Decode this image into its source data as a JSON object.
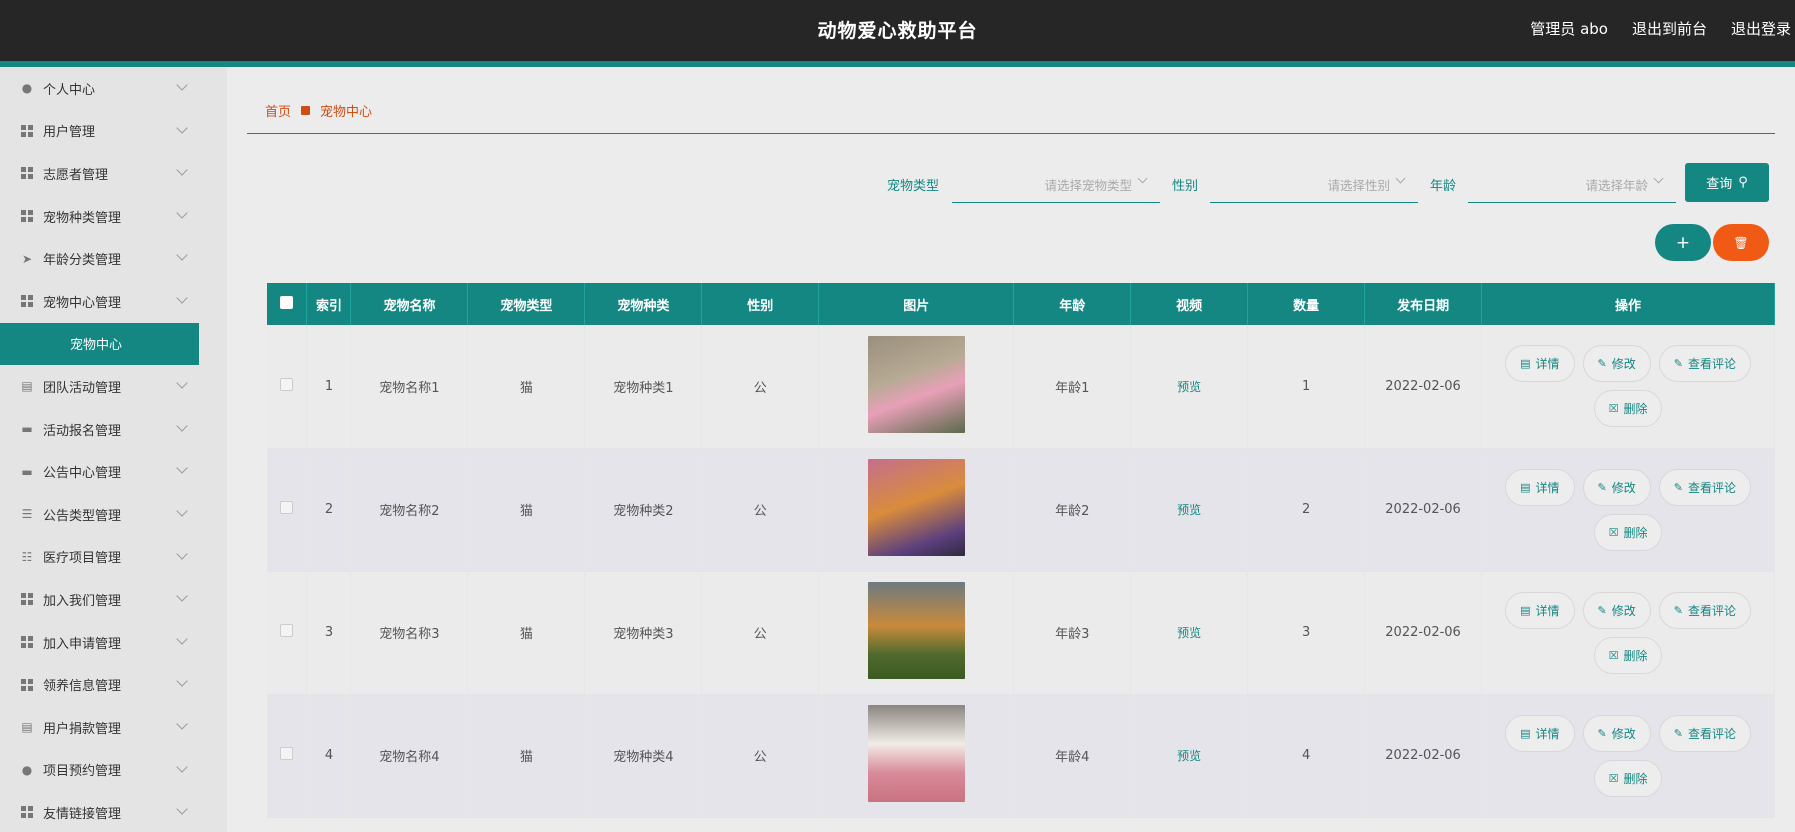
{
  "header": {
    "title": "动物爱心救助平台",
    "admin": "管理员 abo",
    "to_front": "退出到前台",
    "logout": "退出登录"
  },
  "sidebar": {
    "items": [
      {
        "label": "个人中心",
        "icon": "user-icon"
      },
      {
        "label": "用户管理",
        "icon": "grid-icon"
      },
      {
        "label": "志愿者管理",
        "icon": "grid-icon"
      },
      {
        "label": "宠物种类管理",
        "icon": "grid-icon"
      },
      {
        "label": "年龄分类管理",
        "icon": "send-icon"
      },
      {
        "label": "宠物中心管理",
        "icon": "grid-icon"
      },
      {
        "label": "宠物中心",
        "icon": "",
        "active": true
      },
      {
        "label": "团队活动管理",
        "icon": "clipboard-icon"
      },
      {
        "label": "活动报名管理",
        "icon": "monitor-icon"
      },
      {
        "label": "公告中心管理",
        "icon": "monitor-icon"
      },
      {
        "label": "公告类型管理",
        "icon": "list-icon"
      },
      {
        "label": "医疗项目管理",
        "icon": "sliders-icon"
      },
      {
        "label": "加入我们管理",
        "icon": "grid-icon"
      },
      {
        "label": "加入申请管理",
        "icon": "grid-icon"
      },
      {
        "label": "领养信息管理",
        "icon": "grid-icon"
      },
      {
        "label": "用户捐款管理",
        "icon": "clipboard-icon"
      },
      {
        "label": "项目预约管理",
        "icon": "user-icon"
      },
      {
        "label": "友情链接管理",
        "icon": "grid-icon"
      }
    ]
  },
  "breadcrumb": {
    "home": "首页",
    "current": "宠物中心"
  },
  "filters": {
    "type_label": "宠物类型",
    "type_placeholder": "请选择宠物类型",
    "sex_label": "性别",
    "sex_placeholder": "请选择性别",
    "age_label": "年龄",
    "age_placeholder": "请选择年龄",
    "query": "查询"
  },
  "actions": {
    "add": "+",
    "delete": "🗑"
  },
  "table": {
    "columns": [
      "索引",
      "宠物名称",
      "宠物类型",
      "宠物种类",
      "性别",
      "图片",
      "年龄",
      "视频",
      "数量",
      "发布日期",
      "操作"
    ],
    "rows": [
      {
        "index": "1",
        "name": "宠物名称1",
        "type": "猫",
        "kind": "宠物种类1",
        "sex": "公",
        "age": "年龄1",
        "video": "预览",
        "count": "1",
        "date": "2022-02-06"
      },
      {
        "index": "2",
        "name": "宠物名称2",
        "type": "猫",
        "kind": "宠物种类2",
        "sex": "公",
        "age": "年龄2",
        "video": "预览",
        "count": "2",
        "date": "2022-02-06"
      },
      {
        "index": "3",
        "name": "宠物名称3",
        "type": "猫",
        "kind": "宠物种类3",
        "sex": "公",
        "age": "年龄3",
        "video": "预览",
        "count": "3",
        "date": "2022-02-06"
      },
      {
        "index": "4",
        "name": "宠物名称4",
        "type": "猫",
        "kind": "宠物种类4",
        "sex": "公",
        "age": "年龄4",
        "video": "预览",
        "count": "4",
        "date": "2022-02-06"
      }
    ],
    "ops": {
      "detail": "详情",
      "edit": "修改",
      "comments": "查看评论",
      "delete": "删除"
    }
  }
}
